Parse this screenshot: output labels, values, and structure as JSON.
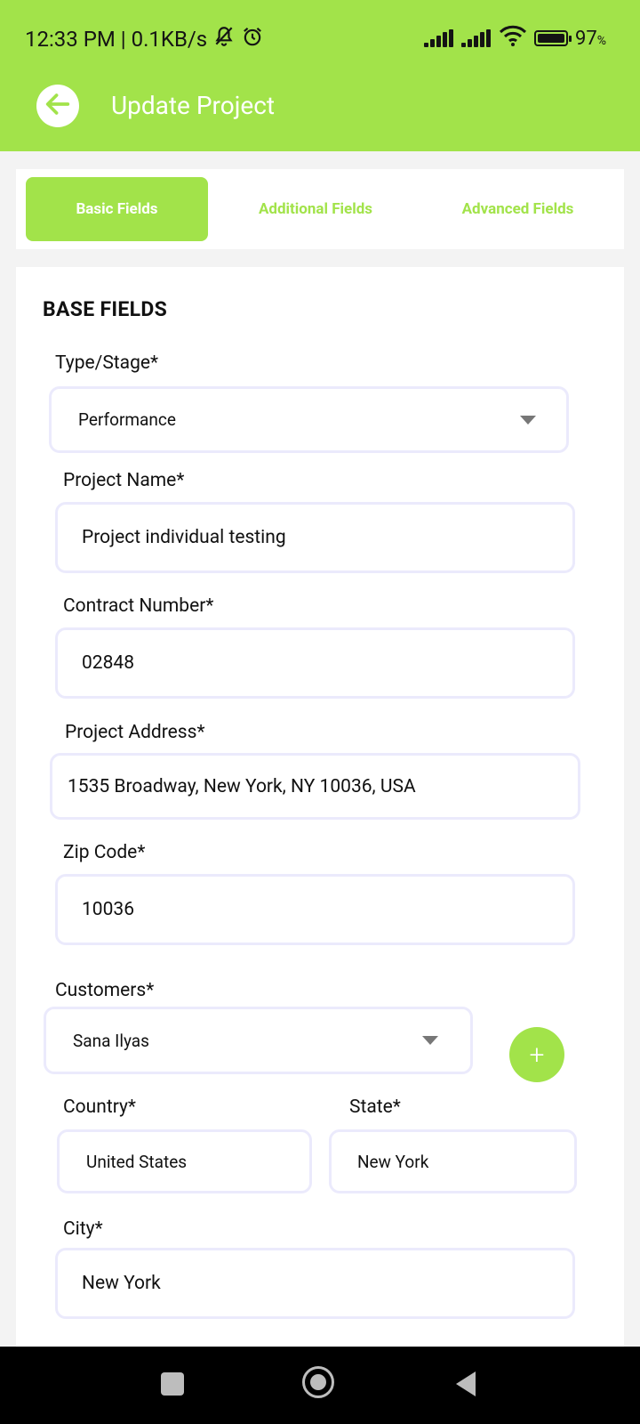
{
  "status_bar": {
    "time_speed": "12:33 PM | 0.1KB/s",
    "battery_pct": "97",
    "battery_unit": "%"
  },
  "header": {
    "title": "Update Project"
  },
  "tabs": [
    {
      "label": "Basic Fields",
      "active": true
    },
    {
      "label": "Additional Fields",
      "active": false
    },
    {
      "label": "Advanced Fields",
      "active": false
    }
  ],
  "form": {
    "section_title": "BASE FIELDS",
    "type_stage": {
      "label": "Type/Stage*",
      "value": "Performance"
    },
    "project_name": {
      "label": "Project Name*",
      "value": "Project individual testing"
    },
    "contract_number": {
      "label": "Contract Number*",
      "value": "02848"
    },
    "project_address": {
      "label": "Project Address*",
      "value": "1535 Broadway, New York, NY 10036, USA"
    },
    "zip_code": {
      "label": "Zip Code*",
      "value": "10036"
    },
    "customers": {
      "label": "Customers*",
      "value": "Sana Ilyas",
      "add_label": "+"
    },
    "country": {
      "label": "Country*",
      "value": "United States"
    },
    "state": {
      "label": "State*",
      "value": "New York"
    },
    "city": {
      "label": "City*",
      "value": "New York"
    }
  },
  "colors": {
    "accent": "#a2e34a",
    "field_border": "#ebeafc"
  },
  "icons": [
    "back-arrow-icon",
    "mute-bell-icon",
    "alarm-icon",
    "signal-icon",
    "wifi-icon",
    "battery-icon",
    "dropdown-caret-icon",
    "plus-icon"
  ]
}
